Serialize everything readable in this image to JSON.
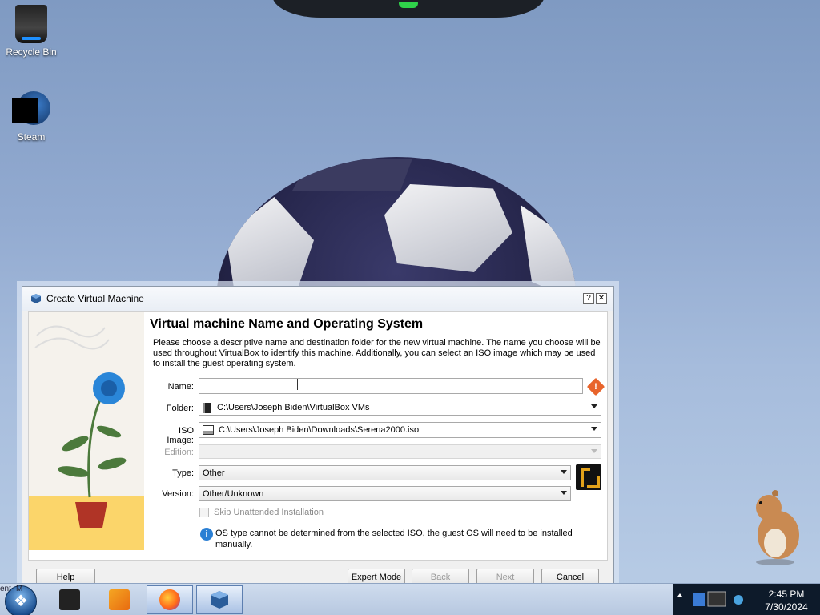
{
  "desktop": {
    "icons": [
      {
        "label": "Recycle Bin",
        "icon": "recycle-bin-icon"
      },
      {
        "label": "Steam",
        "icon": "steam-icon"
      }
    ]
  },
  "dialog": {
    "title": "Create Virtual Machine",
    "title_buttons": {
      "help": "?",
      "close": "✕"
    },
    "heading": "Virtual machine Name and Operating System",
    "description": "Please choose a descriptive name and destination folder for the new virtual machine. The name you choose will be used throughout VirtualBox to identify this machine. Additionally, you can select an ISO image which may be used to install the guest operating system.",
    "fields": {
      "name": {
        "label": "Name:",
        "value": ""
      },
      "folder": {
        "label": "Folder:",
        "value": "C:\\Users\\Joseph Biden\\VirtualBox VMs"
      },
      "iso": {
        "label": "ISO Image:",
        "value": "C:\\Users\\Joseph Biden\\Downloads\\Serena2000.iso"
      },
      "edition": {
        "label": "Edition:",
        "value": ""
      },
      "type": {
        "label": "Type:",
        "value": "Other"
      },
      "version": {
        "label": "Version:",
        "value": "Other/Unknown"
      }
    },
    "skip_unattended": {
      "label": "Skip Unattended Installation",
      "checked": false,
      "enabled": false
    },
    "info_text": "OS type cannot be determined from the selected ISO, the guest OS will need to be installed manually.",
    "buttons": {
      "help": "Help",
      "expert": "Expert Mode",
      "back": "Back",
      "next": "Next",
      "cancel": "Cancel"
    }
  },
  "taskbar": {
    "truncated_label": "ent· M",
    "clock": {
      "time": "2:45 PM",
      "date": "7/30/2024"
    },
    "apps": [
      "media-center-icon",
      "media-player-icon",
      "firefox-icon",
      "virtualbox-icon"
    ]
  },
  "colors": {
    "accent": "#2a7fd4",
    "warning": "#e8642c",
    "taskbar_dark": "#0d1a2a"
  }
}
